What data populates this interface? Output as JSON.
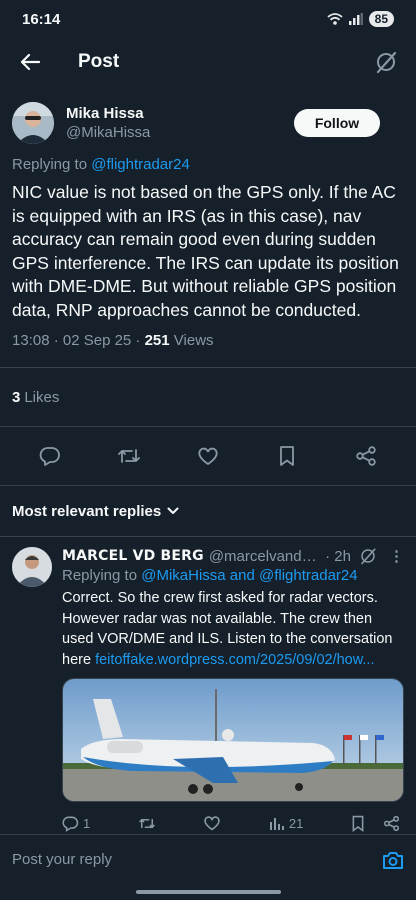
{
  "status_bar": {
    "time": "16:14",
    "battery": "85"
  },
  "header": {
    "title": "Post"
  },
  "tweet": {
    "author_name": "Mika Hissa",
    "author_handle": "@MikaHissa",
    "follow_label": "Follow",
    "replying_prefix": "Replying to ",
    "replying_handle": "@flightradar24",
    "text": "NIC value is not based on the GPS only. If the AC is equipped with an IRS (as in this case), nav accuracy can remain good even during sudden GPS interference. The IRS can update its position with DME-DME. But without reliable GPS position data, RNP approaches cannot be conducted.",
    "timestamp": "13:08 · 02 Sep 25 · ",
    "views_count": "251",
    "views_label": " Views",
    "likes_count": "3",
    "likes_label": "Likes"
  },
  "replies_section": {
    "label": "Most relevant replies"
  },
  "reply": {
    "name": "MARCEL VD BERG",
    "handle": "@marcelvanden...",
    "time": "· 2h",
    "replying_prefix": "Replying to ",
    "replying_handles": "@MikaHissa and @flightradar24",
    "text": "Correct. So the crew first asked for radar vectors. However radar was not available. The crew then used VOR/DME and ILS. Listen to the conversation here ",
    "link": "feitoffake.wordpress.com/2025/09/02/how...",
    "reply_count": "1",
    "view_count": "21"
  },
  "compose": {
    "placeholder": "Post your reply"
  },
  "colors": {
    "background": "#15202b",
    "accent": "#1d9bf0",
    "muted": "#8b98a5",
    "divider": "#38444d"
  }
}
